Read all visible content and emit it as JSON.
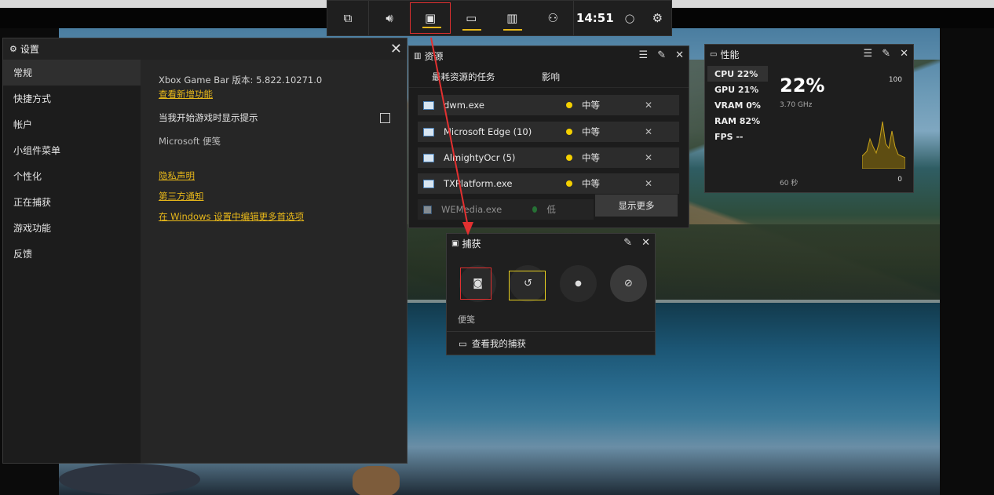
{
  "gamebar": {
    "buttons": [
      {
        "name": "widget-menu-icon",
        "glyph": "⧉"
      },
      {
        "name": "audio-icon",
        "glyph": "🔊︎"
      },
      {
        "name": "capture-icon",
        "glyph": "▣"
      },
      {
        "name": "performance-icon",
        "glyph": "▭"
      },
      {
        "name": "resources-icon",
        "glyph": "▥"
      },
      {
        "name": "social-icon",
        "glyph": "⚇"
      }
    ],
    "time": "14:51",
    "mouse_glyph": "◯",
    "settings_glyph": "⚙"
  },
  "settings": {
    "title": "设置",
    "title_glyph": "⚙",
    "close_glyph": "✕",
    "nav": [
      "常规",
      "快捷方式",
      "帐户",
      "小组件菜单",
      "个性化",
      "正在捕获",
      "游戏功能",
      "反馈"
    ],
    "version": "Xbox Game Bar 版本: 5.822.10271.0",
    "whats_new": "查看新增功能",
    "show_tips": "当我开始游戏时显示提示",
    "ms_note": "Microsoft 便笺",
    "privacy": "隐私声明",
    "third_party": "第三方通知",
    "edit_more": "在 Windows 设置中编辑更多首选项"
  },
  "resources": {
    "title": "资源",
    "col_task": "最耗资源的任务",
    "col_impact": "影响",
    "rows": [
      {
        "name": "dwm.exe",
        "impact": "中等",
        "color": "#f4d000"
      },
      {
        "name": "Microsoft Edge (10)",
        "impact": "中等",
        "color": "#f4d000"
      },
      {
        "name": "AlmightyOcr (5)",
        "impact": "中等",
        "color": "#f4d000"
      },
      {
        "name": "TXPlatform.exe",
        "impact": "中等",
        "color": "#f4d000"
      },
      {
        "name": "WEMedia.exe",
        "impact": "低",
        "color": "#2fb84a"
      }
    ],
    "show_more": "显示更多"
  },
  "performance": {
    "title": "性能",
    "items": [
      "CPU  22%",
      "GPU  21%",
      "VRAM  0%",
      "RAM  82%",
      "FPS --"
    ],
    "big_value": "22%",
    "ghz": "3.70 GHz",
    "max": "100",
    "min": "0",
    "secs": "60 秒",
    "accent": "#c7a21a"
  },
  "capture": {
    "title": "捕获",
    "note": "便笺",
    "view": "查看我的捕获"
  }
}
